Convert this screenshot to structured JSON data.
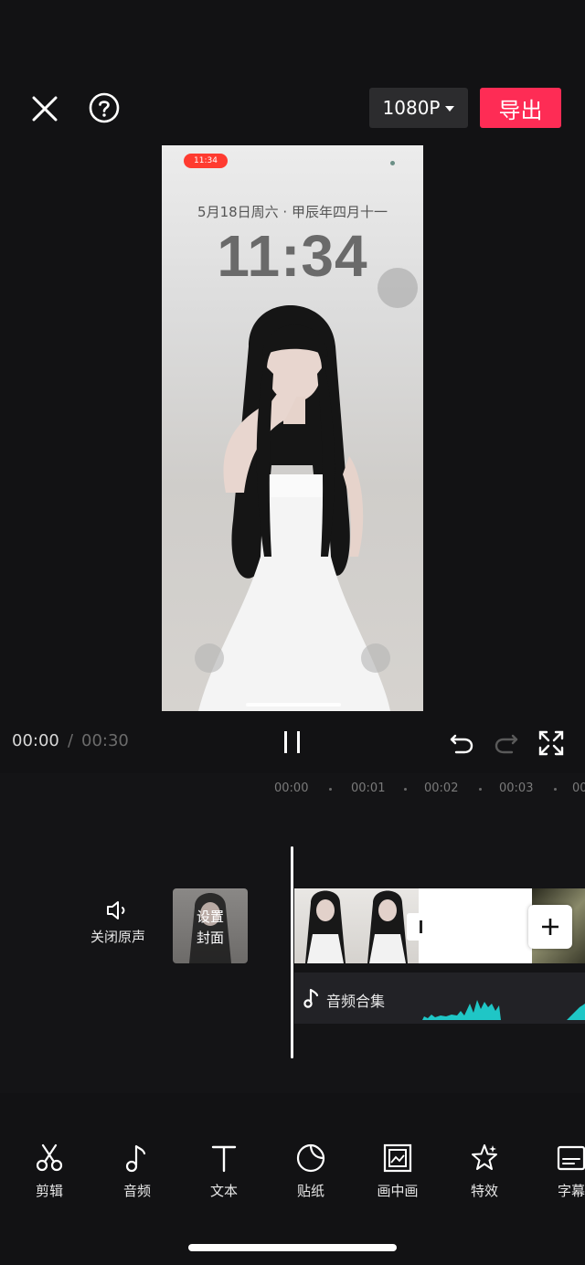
{
  "topbar": {
    "close_icon": "close-icon",
    "help_icon": "help-icon",
    "resolution": "1080P",
    "export_label": "导出",
    "export_color": "#fe2c55"
  },
  "preview": {
    "status_pill": "11:34",
    "date_line": "5月18日周六 · 甲辰年四月十一",
    "time": "11:34"
  },
  "playback": {
    "current_time": "00:00",
    "separator": "/",
    "total_time": "00:30"
  },
  "ruler": {
    "labels": [
      "00:00",
      "00:01",
      "00:02",
      "00:03",
      "00"
    ]
  },
  "timeline": {
    "mute_label": "关闭原声",
    "cover_label_line1": "设置",
    "cover_label_line2": "封面",
    "audio_label": "音频合集",
    "waveform_color": "#1fc6c6"
  },
  "toolbar": {
    "items": [
      {
        "label": "剪辑",
        "icon": "scissors-icon"
      },
      {
        "label": "音频",
        "icon": "music-note-icon"
      },
      {
        "label": "文本",
        "icon": "text-icon"
      },
      {
        "label": "贴纸",
        "icon": "sticker-icon"
      },
      {
        "label": "画中画",
        "icon": "picture-in-picture-icon"
      },
      {
        "label": "特效",
        "icon": "effects-star-icon"
      },
      {
        "label": "字幕",
        "icon": "subtitle-icon"
      }
    ]
  }
}
